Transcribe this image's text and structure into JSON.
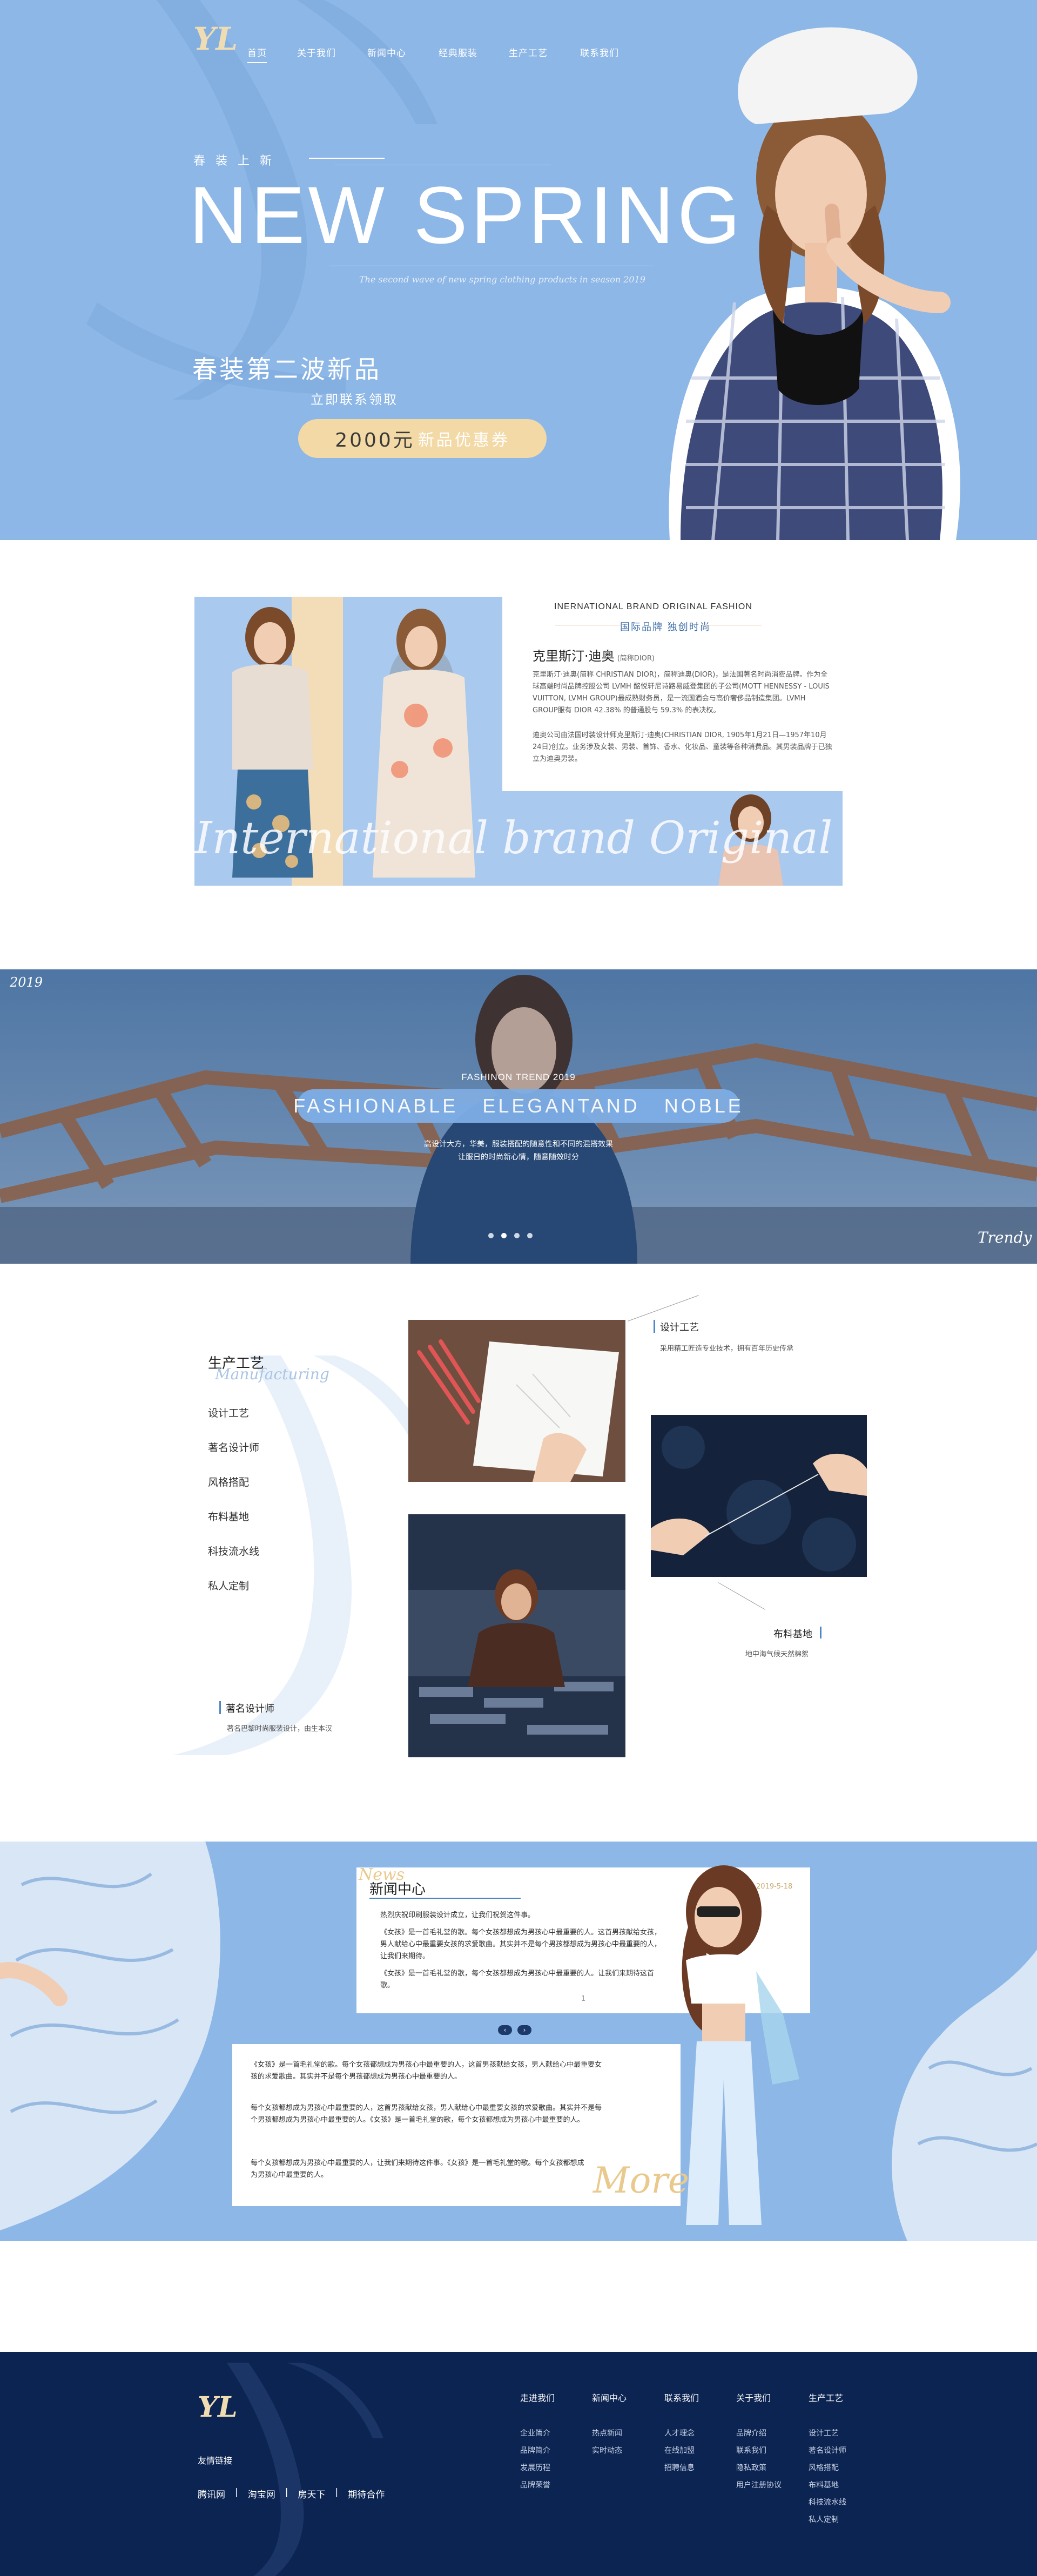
{
  "colors": {
    "brand_blue": "#8db7e6",
    "navy": "#0c2452",
    "gold": "#f0dcb3",
    "accent_blue": "#4f86c6"
  },
  "logo": {
    "text": "YL"
  },
  "nav": {
    "items": [
      "首页",
      "关于我们",
      "新闻中心",
      "经典服装",
      "生产工艺",
      "联系我们"
    ]
  },
  "hero": {
    "eyebrow": "春 装 上 新",
    "title": "NEW SPRING",
    "tagline": "The second wave of new spring clothing products in season 2019",
    "subtitle": "春装第二波新品",
    "contact": "立即联系领取",
    "coupon_amount": "2000元",
    "coupon_label": "新品优惠券"
  },
  "brand": {
    "eyebrow_en": "INERNATIONAL BRAND   ORIGINAL FASHION",
    "eyebrow_cn": "国际品牌 独创时尚",
    "name_cn": "克里斯汀·迪奥",
    "name_note": "(简称DIOR)",
    "para1": "克里斯汀·迪奥(简称 CHRISTIAN DIOR)，简称迪奥(DIOR)，是法国著名时尚消费品牌。作为全球高端时尚品牌控股公司 LVMH 酩悦轩尼诗路易威登集团的子公司(MOTT HENNESSY - LOUIS VUITTON, LVMH GROUP)最成熟财务员，是一流国酒会与高价奢侈品制造集团。LVMH GROUP服有 DIOR 42.38% 的普通股与 59.3% 的表决权。",
    "para2": "迪奥公司由法国时装设计师克里斯汀·迪奥(CHRISTIAN DIOR, 1905年1月21日—1957年10月24日)创立。业务涉及女装、男装、首饰、香水、化妆品、童装等各种消费品。其男装品牌于已独立为迪奥男装。",
    "watermark": "International brand Original fash"
  },
  "banner": {
    "year": "2019",
    "eyebrow": "FASHINON TREND 2019",
    "title": "FASHIONABLE   ELEGANTAND   NOBLE",
    "desc1": "高设计大方，华美，服装搭配的随意性和不同的混搭效果",
    "desc2": "让服日的时尚新心情，随意随效时分",
    "signature": "Trendy",
    "dots": 4,
    "active_dot": 1
  },
  "production": {
    "title": "生产工艺",
    "subtitle_en": "Manufacturing",
    "links": [
      "设计工艺",
      "著名设计师",
      "风格搭配",
      "布料基地",
      "科技流水线",
      "私人定制"
    ],
    "card_design_title": "设计工艺",
    "card_design_desc": "采用精工匠造专业技术，拥有百年历史传承",
    "card_fabric_title": "布料基地",
    "card_fabric_desc": "地中海气候天然棉絮",
    "card_designer_title": "著名设计师",
    "card_designer_desc": "著名巴黎时尚服装设计，由生本汉"
  },
  "news": {
    "title": "新闻中心",
    "title_en": "News",
    "date": "2019-5-18",
    "lead": "热烈庆祝印刷服装设计成立，让我们祝贺这件事。",
    "body1": "《女孩》是一首毛礼堂的歌。每个女孩都想成为男孩心中最重要的人。这首男孩献给女孩，男人献给心中最重要女孩的求爱歌曲。其实并不是每个男孩都想成为男孩心中最重要的人，让我们来期待。",
    "body2": "《女孩》是一首毛礼堂的歌，每个女孩都想成为男孩心中最重要的人。让我们来期待这首歌。",
    "page_indicator": "1",
    "pager": [
      "‹",
      "›"
    ],
    "box2_p1": "《女孩》是一首毛礼堂的歌。每个女孩都想成为男孩心中最重要的人，这首男孩献给女孩，男人献给心中最重要女孩的求爱歌曲。其实并不是每个男孩都想成为男孩心中最重要的人。",
    "box2_p2": "每个女孩都想成为男孩心中最重要的人，这首男孩献给女孩，男人献给心中最重要女孩的求爱歌曲。其实并不是每个男孩都想成为男孩心中最重要的人。《女孩》是一首毛礼堂的歌，每个女孩都想成为男孩心中最重要的人。",
    "box2_p3": "每个女孩都想成为男孩心中最重要的人，让我们来期待这件事。《女孩》是一首毛礼堂的歌。每个女孩都想成为男孩心中最重要的人。",
    "more": "More"
  },
  "footer": {
    "friend_links_title": "友情链接",
    "friend_links": [
      "腾讯网",
      "淘宝网",
      "房天下",
      "期待合作"
    ],
    "columns": [
      {
        "title": "走进我们",
        "items": [
          "企业简介",
          "品牌简介",
          "发展历程",
          "品牌荣誉"
        ]
      },
      {
        "title": "新闻中心",
        "items": [
          "热点新闻",
          "实时动态"
        ]
      },
      {
        "title": "联系我们",
        "items": [
          "人才理念",
          "在线加盟",
          "招聘信息"
        ]
      },
      {
        "title": "关于我们",
        "items": [
          "品牌介绍",
          "联系我们",
          "隐私政策",
          "用户注册协议"
        ]
      },
      {
        "title": "生产工艺",
        "items": [
          "设计工艺",
          "著名设计师",
          "风格搭配",
          "布料基地",
          "科技流水线",
          "私人定制"
        ]
      }
    ]
  }
}
